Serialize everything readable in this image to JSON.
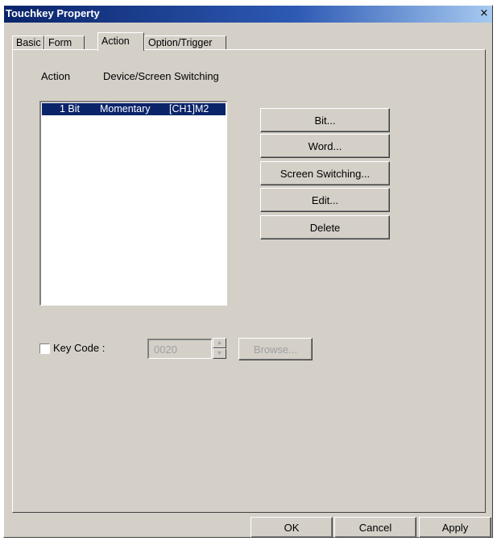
{
  "window": {
    "title": "Touchkey Property",
    "close_glyph": "×"
  },
  "tabs": [
    {
      "label": "Basic",
      "active": false
    },
    {
      "label": "Form",
      "active": false
    },
    {
      "label": "Action",
      "active": true
    },
    {
      "label": "Option/Trigger",
      "active": false
    }
  ],
  "action_list": {
    "header_action": "Action",
    "header_type": "Device/Screen Switching",
    "rows": [
      {
        "type": "1 Bit",
        "mode": "Momentary",
        "device": "[CH1]M2",
        "selected": true
      }
    ]
  },
  "action_buttons": {
    "bit": "Bit...",
    "word": "Word...",
    "screen_switching": "Screen Switching...",
    "edit": "Edit...",
    "delete": "Delete"
  },
  "key_code": {
    "label": "Key Code :",
    "checked": false,
    "value": "0020",
    "browse": "Browse...",
    "enabled": false
  },
  "footer": {
    "ok": "OK",
    "cancel": "Cancel",
    "apply": "Apply"
  },
  "colors": {
    "title_bar": "#0a246a",
    "selection": "#0a246a",
    "face": "#d4d0c8"
  }
}
